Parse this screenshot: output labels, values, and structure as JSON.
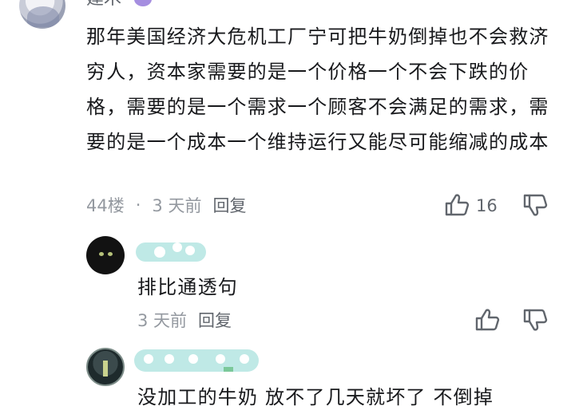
{
  "main_comment": {
    "username_partial": "建木",
    "text": "那年美国经济大危机工厂宁可把牛奶倒掉也不会救济穷人，资本家需要的是一个价格一个不会下跌的价格，需要的是一个需求一个顾客不会满足的需求，需要的是一个成本一个维持运行又能尽可能缩减的成本",
    "floor": "44楼",
    "separator": "·",
    "time": "3 天前",
    "reply_label": "回复",
    "like_count": "16"
  },
  "reply_1": {
    "text": "排比通透句",
    "time": "3 天前",
    "reply_label": "回复"
  },
  "reply_2": {
    "text": "没加工的牛奶 放不了几天就坏了 不倒掉"
  },
  "colors": {
    "text": "#18191c",
    "meta": "#9499a0",
    "icon": "#61666d",
    "mask": "#bfe9e6",
    "level_badge": "#a58ee0"
  }
}
